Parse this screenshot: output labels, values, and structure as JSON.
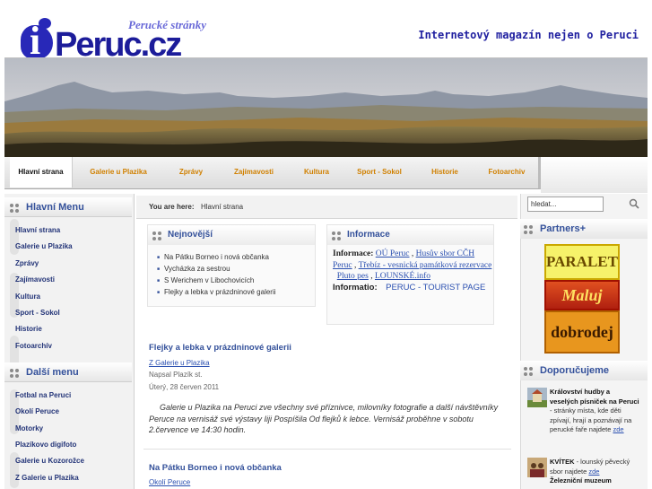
{
  "site": {
    "logo_tag": "Perucké stránky",
    "logo_i": "i",
    "logo_word": "Peruc.cz",
    "tagline": "Internetový magazín nejen o Peruci"
  },
  "nav": {
    "tabs": [
      "Hlavní strana",
      "Galerie u Plazika",
      "Zprávy",
      "Zajímavosti",
      "Kultura",
      "Sport - Sokol",
      "Historie",
      "Fotoarchiv"
    ],
    "active_index": 0
  },
  "left": {
    "main_menu_title": "Hlavní Menu",
    "main_menu": [
      "Hlavní strana",
      "Galerie u Plazika",
      "Zprávy",
      "Zajímavosti",
      "Kultura",
      "Sport - Sokol",
      "Historie",
      "Fotoarchív"
    ],
    "more_menu_title": "Další menu",
    "more_menu": [
      "Fotbal na Peruci",
      "Okolí Peruce",
      "Motorky",
      "Plazíkovo digifoto",
      "Galerie u Kozorožce",
      "Z Galerie u Plazika"
    ]
  },
  "breadcrumb": {
    "label": "You are here:",
    "value": "Hlavní strana"
  },
  "latest": {
    "title": "Nejnovější",
    "items": [
      "Na Pátku Borneo i nová občanka",
      "Vycházka za sestrou",
      "S Werichem v Libochovicích",
      "Flejky a lebka v prázdninové galerii"
    ]
  },
  "info": {
    "title": "Informace",
    "label": "Informace:",
    "links": [
      "OÚ Peruc",
      "Husův sbor CČH Peruc",
      "Třebíz - vesnická památková rezervace",
      "Pluto pes",
      "LOUNSKÉ.info"
    ],
    "label2": "Informatio:",
    "link2": "PERUC - TOURIST PAGE"
  },
  "articles": [
    {
      "title": "Flejky a lebka v prázdninové galerii",
      "category": "Z Galerie u Plazika",
      "author": "Napsal Plazík st.",
      "date": "Úterý, 28 červen 2011",
      "body": "Galerie u Plazika na Peruci zve všechny své příznivce, milovníky fotografie a další návštěvníky Peruce na vernisáž své výstavy Iiji Pospíšila Od flejků k lebce. Vernisáž proběhne v sobotu 2.července ve 14:30 hodin."
    },
    {
      "title": "Na Pátku Borneo i nová občanka",
      "category": "Okolí Peruce"
    }
  ],
  "right": {
    "search_value": "hledat...",
    "partners_title": "Partners+",
    "partners": [
      "PARALET",
      "Maluj",
      "dobrodej"
    ],
    "recommend_title": "Doporučujeme",
    "rec1_bold": "Království hudby a veselých písniček na Peruci",
    "rec1_text": " - stránky místa, kde děti zpívají, hrají a poznávají na perucké faře najdete ",
    "rec1_link": "zde",
    "rec2_bold": "KVÍTEK",
    "rec2_text": " - lounský pěvecký sbor najdete ",
    "rec2_link": "zde",
    "rec3_bold": "Železniční muzeum"
  },
  "colors": {
    "accent": "#33509a",
    "nav_text": "#d08000",
    "link": "#2a4fb0"
  }
}
